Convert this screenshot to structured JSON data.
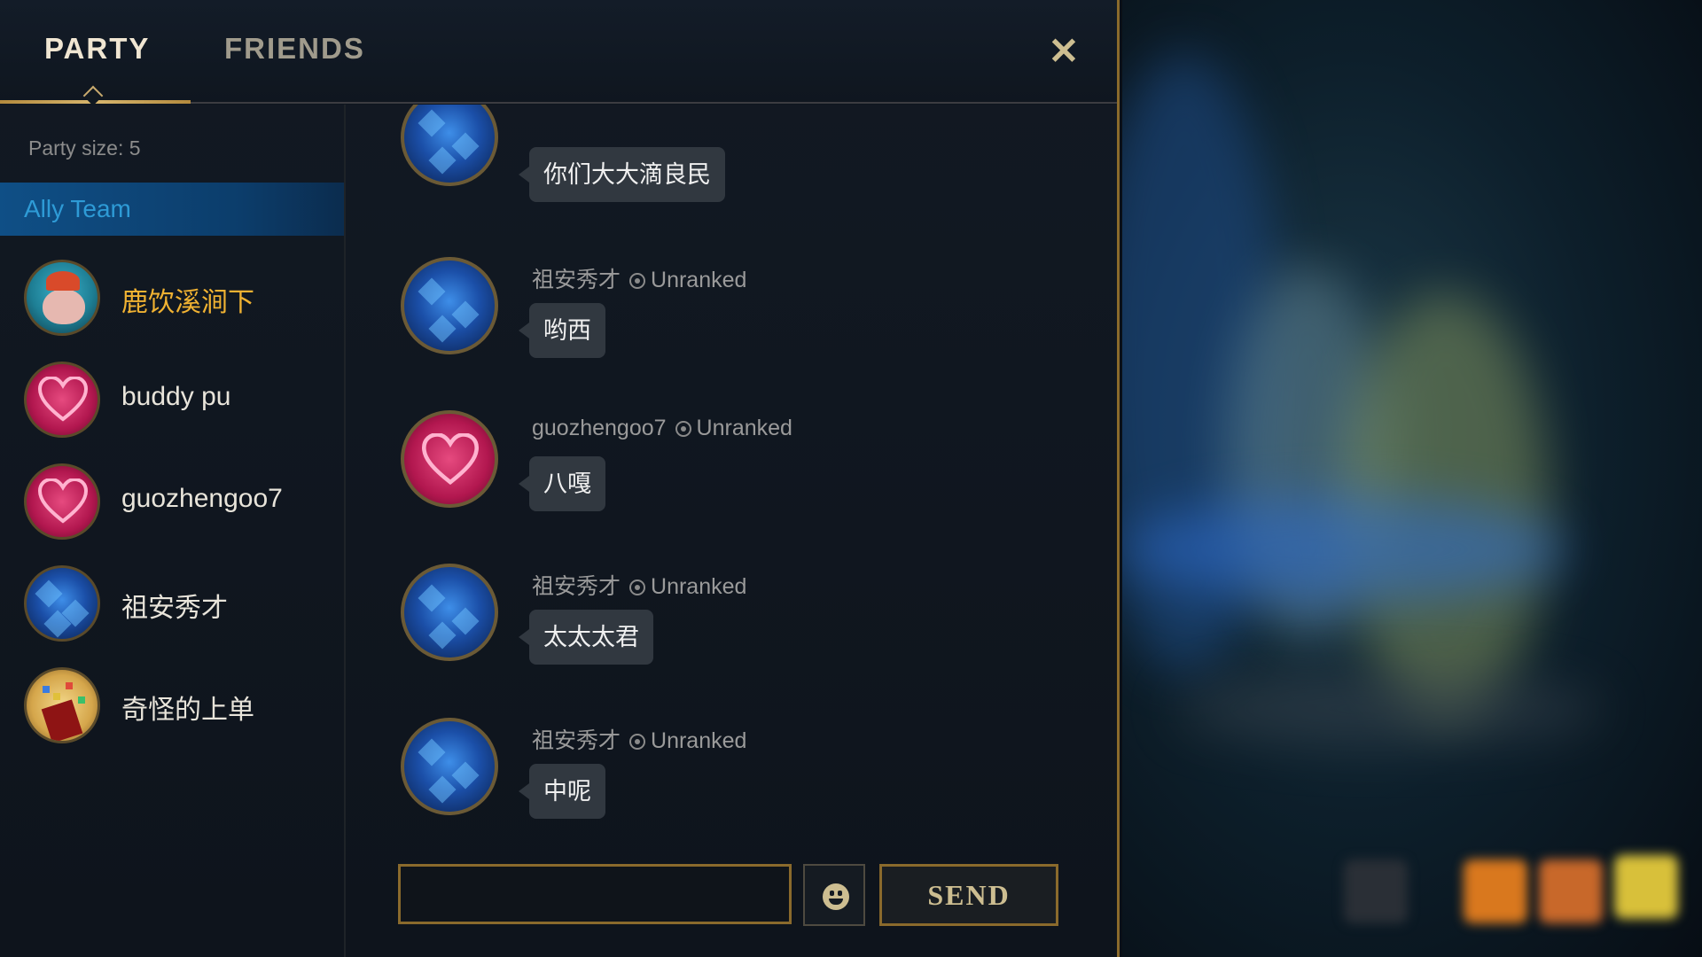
{
  "tabs": {
    "party": "PARTY",
    "friends": "FRIENDS",
    "close_icon": "close-icon"
  },
  "sidebar": {
    "party_size": "Party size: 5",
    "team_label": "Ally Team",
    "members": [
      {
        "name": "鹿饮溪涧下",
        "avatar": "deer-icon",
        "highlight": true
      },
      {
        "name": "buddy pu",
        "avatar": "heart-icon"
      },
      {
        "name": "guozhengoo7",
        "avatar": "heart-icon"
      },
      {
        "name": "祖安秀才",
        "avatar": "blue-crystal-icon"
      },
      {
        "name": "奇怪的上单",
        "avatar": "party-cup-icon"
      }
    ]
  },
  "chat": {
    "messages": [
      {
        "sender": "",
        "rank": "",
        "text": "你们大大滴良民",
        "avatar": "blue-crystal-icon"
      },
      {
        "sender": "祖安秀才",
        "rank": "Unranked",
        "text": "哟西",
        "avatar": "blue-crystal-icon"
      },
      {
        "sender": "guozhengoo7",
        "rank": "Unranked",
        "text": "八嘎",
        "avatar": "heart-icon"
      },
      {
        "sender": "祖安秀才",
        "rank": "Unranked",
        "text": "太太太君",
        "avatar": "blue-crystal-icon"
      },
      {
        "sender": "祖安秀才",
        "rank": "Unranked",
        "text": "中呢",
        "avatar": "blue-crystal-icon"
      }
    ],
    "input_value": "",
    "emoji_icon": "emoji-smile-icon",
    "send_label": "SEND"
  },
  "colors": {
    "gold_border": "#8a6a2c",
    "highlight_name": "#f0b232",
    "ally_team_bg": "#0f4f86",
    "ally_team_text": "#2e9bd6",
    "bubble_bg": "#313840"
  }
}
